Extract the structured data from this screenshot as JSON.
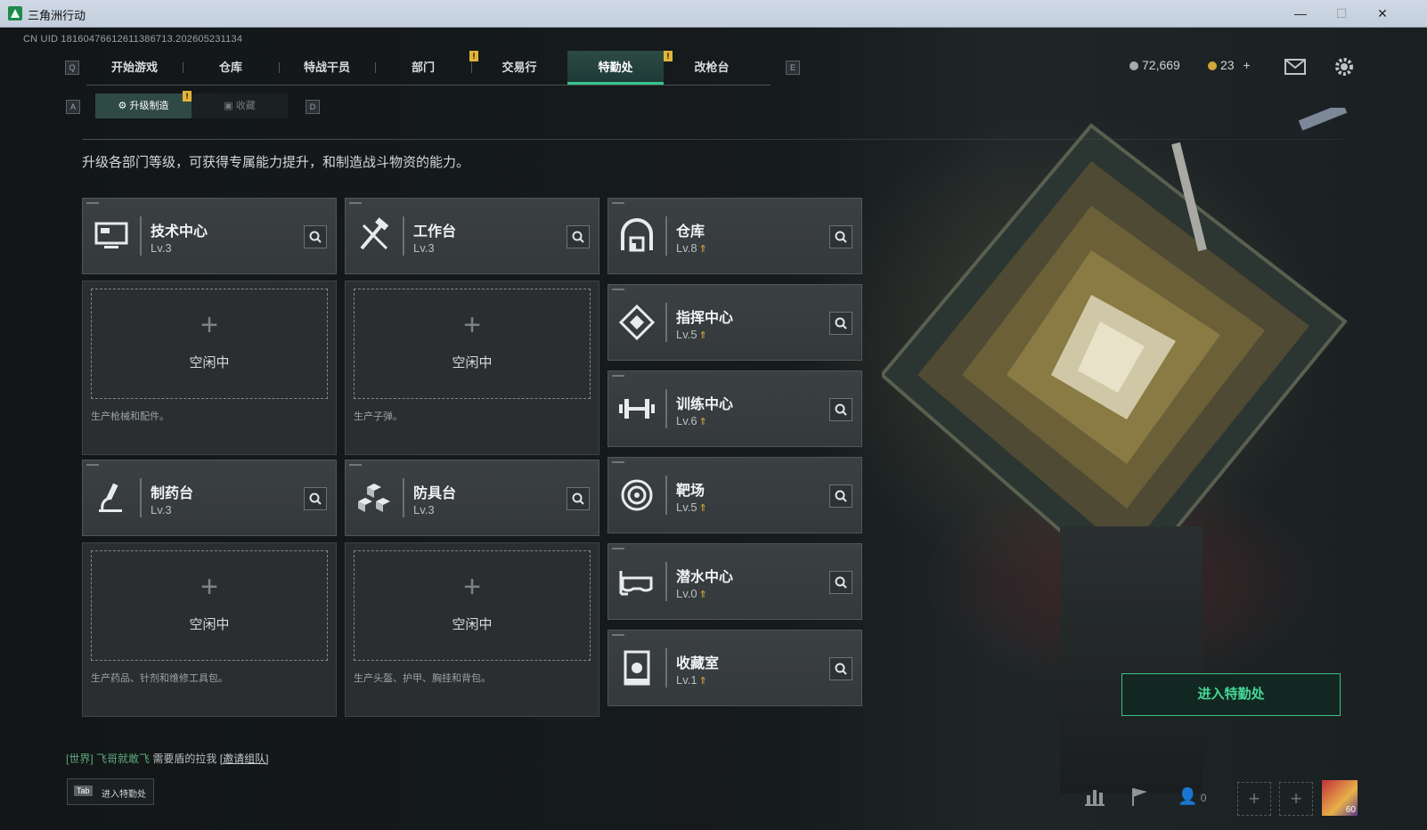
{
  "window": {
    "title": "三角洲行动",
    "controls": {
      "minimize": "—",
      "maximize": "☐",
      "close": "✕"
    }
  },
  "uid": "CN UID 18160476612611386713.202605231134",
  "nav": {
    "left_key": "Q",
    "right_key": "E",
    "tabs": [
      {
        "label": "开始游戏",
        "active": false
      },
      {
        "label": "仓库",
        "active": false
      },
      {
        "label": "特战干员",
        "active": false
      },
      {
        "label": "部门",
        "active": false,
        "badge": "!"
      },
      {
        "label": "交易行",
        "active": false
      },
      {
        "label": "特勤处",
        "active": true,
        "badge": "!"
      },
      {
        "label": "改枪台",
        "active": false
      }
    ]
  },
  "currency": {
    "coins": "72,669",
    "gold": "23",
    "add": "+"
  },
  "subtabs": {
    "left_key": "A",
    "right_key": "D",
    "items": [
      {
        "label": "升级制造",
        "active": true,
        "badge": "!"
      },
      {
        "label": "收藏",
        "active": false
      }
    ]
  },
  "description": "升级各部门等级，可获得专属能力提升，和制造战斗物资的能力。",
  "departments": {
    "production": [
      {
        "name": "技术中心",
        "level": "Lv.3",
        "icon": "computer-icon",
        "slot_status": "空闲中",
        "slot_note": "生产枪械和配件。"
      },
      {
        "name": "工作台",
        "level": "Lv.3",
        "icon": "tools-icon",
        "slot_status": "空闲中",
        "slot_note": "生产子弹。"
      },
      {
        "name": "制药台",
        "level": "Lv.3",
        "icon": "microscope-icon",
        "slot_status": "空闲中",
        "slot_note": "生产药品、针剂和维修工具包。"
      },
      {
        "name": "防具台",
        "level": "Lv.3",
        "icon": "blocks-icon",
        "slot_status": "空闲中",
        "slot_note": "生产头盔、护甲、胸挂和背包。"
      }
    ],
    "facilities": [
      {
        "name": "仓库",
        "level": "Lv.8",
        "icon": "warehouse-icon"
      },
      {
        "name": "指挥中心",
        "level": "Lv.5",
        "icon": "command-icon"
      },
      {
        "name": "训练中心",
        "level": "Lv.6",
        "icon": "dumbbell-icon"
      },
      {
        "name": "靶场",
        "level": "Lv.5",
        "icon": "target-icon"
      },
      {
        "name": "潜水中心",
        "level": "Lv.0",
        "icon": "diving-mask-icon"
      },
      {
        "name": "收藏室",
        "level": "Lv.1",
        "icon": "collection-icon"
      }
    ]
  },
  "enter_button": "进入特勤处",
  "chat": {
    "channel": "[世界]",
    "user": "飞哥就敢飞",
    "message": "需要盾的拉我",
    "link": "[邀请组队]"
  },
  "tab_hint": {
    "key": "Tab",
    "label": "进入特勤处"
  },
  "bottom": {
    "online_count": "0",
    "avatar_level": "60"
  },
  "colors": {
    "accent": "#38c48a",
    "badge": "#e3b43a",
    "card_bg": "#3b4043"
  }
}
